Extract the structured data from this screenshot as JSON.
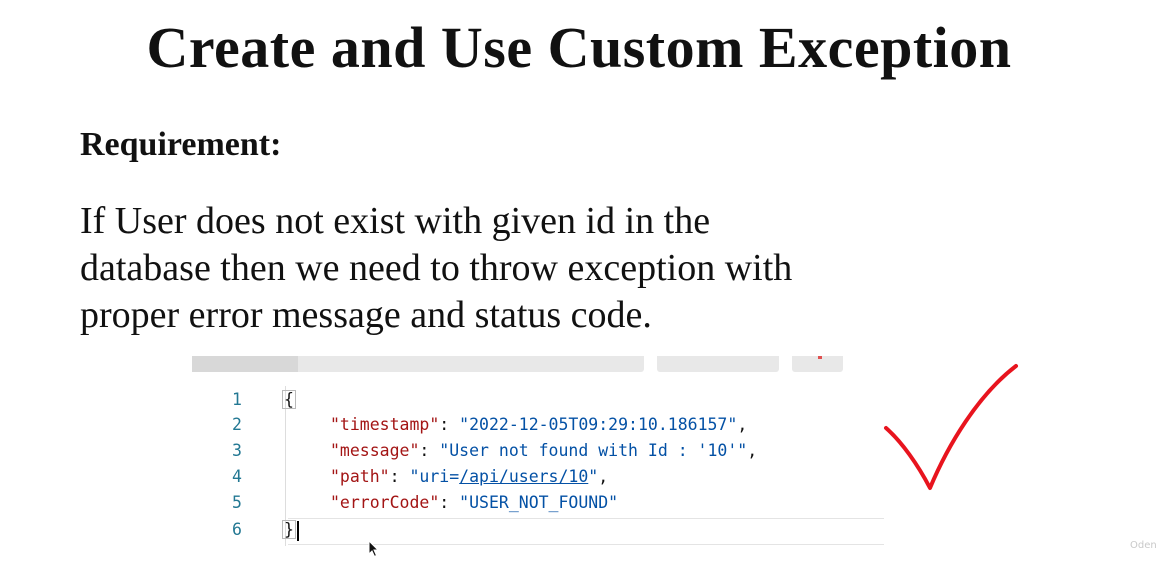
{
  "slide": {
    "title": "Create and Use Custom Exception",
    "requirement_label": "Requirement:",
    "description_lines": [
      "If User does not exist with given id in the",
      "database then we need to throw exception with",
      "proper error message and status code."
    ]
  },
  "editor": {
    "line_numbers": [
      "1",
      "2",
      "3",
      "4",
      "5",
      "6"
    ],
    "open_brace": "{",
    "close_brace": "}",
    "fields": [
      {
        "key": "\"timestamp\"",
        "sep": ": ",
        "value": "\"2022-12-05T09:29:10.186157\"",
        "trail": ","
      },
      {
        "key": "\"message\"",
        "sep": ": ",
        "value": "\"User not found with Id : '10'\"",
        "trail": ","
      },
      {
        "key": "\"path\"",
        "sep": ": ",
        "value_prefix": "\"uri=",
        "value_link": "/api/users/10",
        "value_suffix": "\"",
        "trail": ","
      },
      {
        "key": "\"errorCode\"",
        "sep": ": ",
        "value": "\"USER_NOT_FOUND\"",
        "trail": ""
      }
    ]
  },
  "annotation": {
    "checkmark_color": "#e8141e",
    "checkmark_icon": "checkmark-icon"
  },
  "watermark": "Oden"
}
